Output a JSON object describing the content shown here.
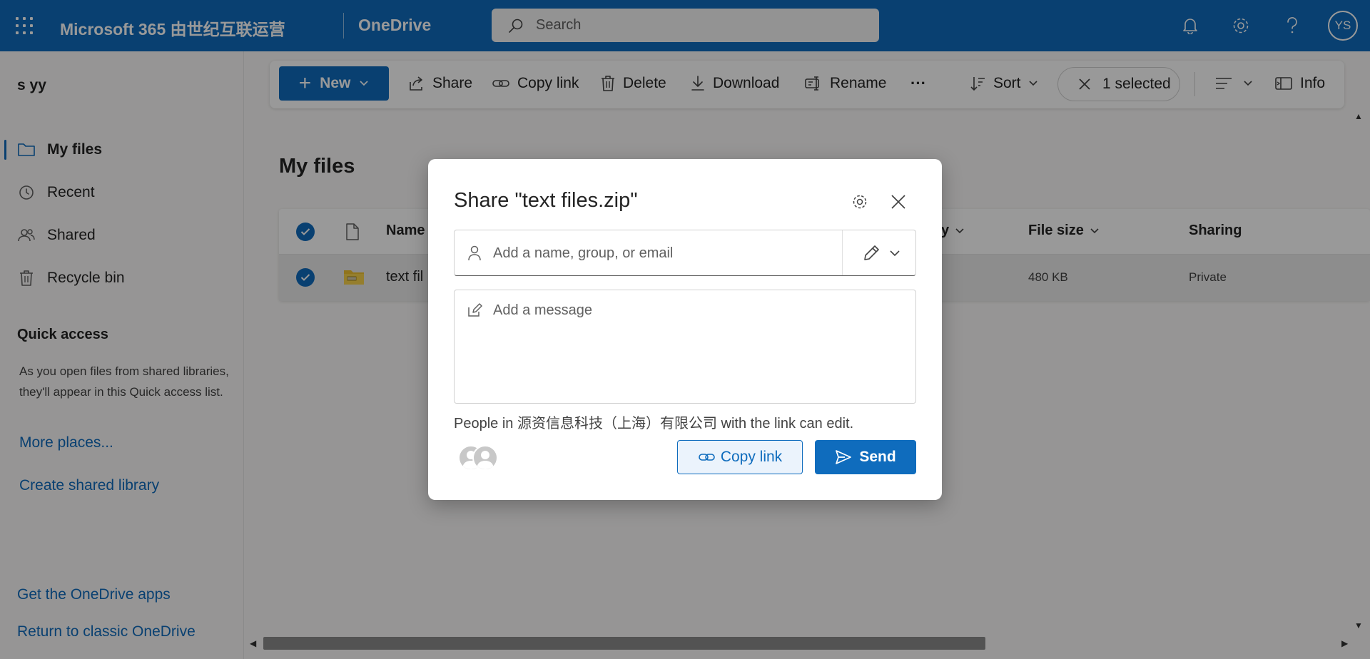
{
  "topbar": {
    "brand": "Microsoft 365 由世纪互联运营",
    "app_name": "OneDrive",
    "search_placeholder": "Search",
    "avatar_initials": "YS"
  },
  "sidebar": {
    "user_name": "s yy",
    "items": [
      {
        "label": "My files",
        "icon": "folder-icon",
        "active": true
      },
      {
        "label": "Recent",
        "icon": "history-icon",
        "active": false
      },
      {
        "label": "Shared",
        "icon": "people-icon",
        "active": false
      },
      {
        "label": "Recycle bin",
        "icon": "trash-icon",
        "active": false
      }
    ],
    "quick_access_title": "Quick access",
    "quick_access_text": "As you open files from shared libraries, they'll appear in this Quick access list.",
    "more_places": "More places...",
    "create_library": "Create shared library",
    "get_apps": "Get the OneDrive apps",
    "classic": "Return to classic OneDrive"
  },
  "commandbar": {
    "new_label": "New",
    "share_label": "Share",
    "copy_link_label": "Copy link",
    "delete_label": "Delete",
    "download_label": "Download",
    "rename_label": "Rename",
    "more_label": "···",
    "sort_label": "Sort",
    "selected_label": "1 selected",
    "info_label": "Info"
  },
  "main": {
    "page_title": "My files",
    "columns": {
      "name": "Name",
      "modified_partial": "y",
      "file_size": "File size",
      "sharing": "Sharing"
    },
    "rows": [
      {
        "name": "text fil",
        "file_size": "480 KB",
        "sharing": "Private",
        "selected": true
      }
    ]
  },
  "dialog": {
    "title": "Share \"text files.zip\"",
    "people_placeholder": "Add a name, group, or email",
    "message_placeholder": "Add a message",
    "link_scope": "People in 源资信息科技（上海）有限公司 with the link can edit.",
    "copy_link_label": "Copy link",
    "send_label": "Send"
  },
  "colors": {
    "accent": "#0f6cbd",
    "overlay": "rgba(0,0,0,0.4)"
  }
}
